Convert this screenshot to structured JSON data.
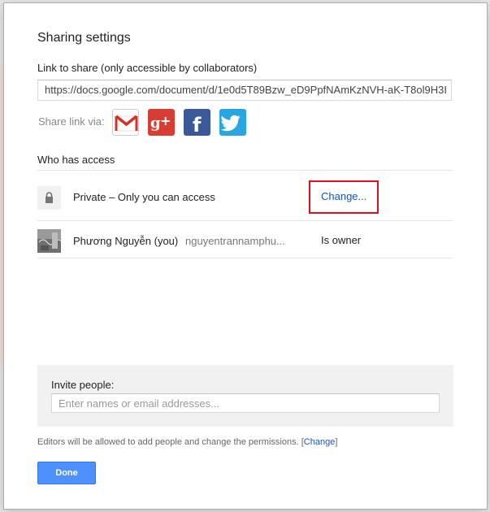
{
  "dialog": {
    "title": "Sharing settings",
    "link_label": "Link to share (only accessible by collaborators)",
    "link_value": "https://docs.google.com/document/d/1e0d5T89Bzw_eD9PpfNAmKzNVH-aK-T8ol9H3I",
    "share_via_label": "Share link via:",
    "social": [
      {
        "name": "gmail-icon",
        "color": "#ffffff"
      },
      {
        "name": "google-plus-icon",
        "color": "#d73d32"
      },
      {
        "name": "facebook-icon",
        "color": "#3b5998"
      },
      {
        "name": "twitter-icon",
        "color": "#27a6e1"
      }
    ],
    "who_has_access": "Who has access",
    "access_row": {
      "icon": "lock-icon",
      "text": "Private – Only you can access",
      "change_label": "Change..."
    },
    "owner_row": {
      "name": "Phương Nguyễn (you)",
      "email": "nguyentrannamphu...",
      "role": "Is owner"
    },
    "invite": {
      "label": "Invite people:",
      "placeholder": "Enter names or email addresses..."
    },
    "editors_note": "Editors will be allowed to add people and change the permissions.",
    "editors_change": "Change",
    "done_label": "Done"
  },
  "colors": {
    "accent": "#4d90fe",
    "link": "#1155cc",
    "highlight": "#e0101e"
  }
}
